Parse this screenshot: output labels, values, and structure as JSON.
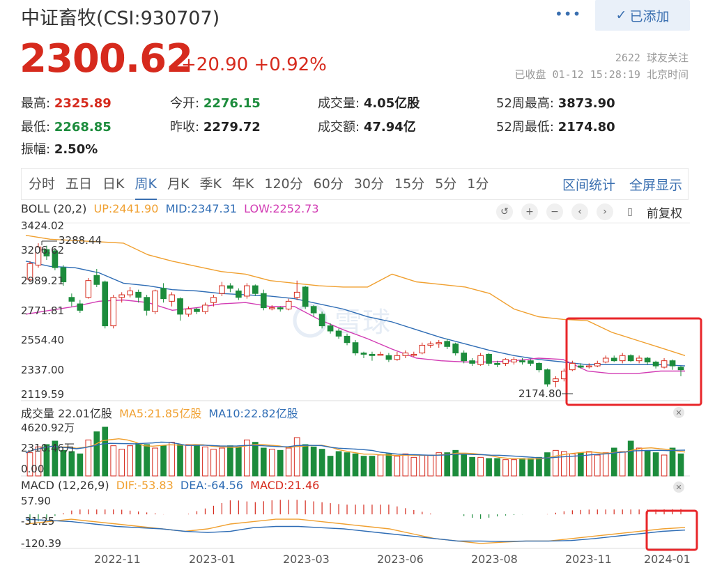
{
  "header": {
    "title": "中证畜牧(CSI:930707)",
    "more_icon": "more-dots-icon",
    "added_label": "已添加",
    "price": "2300.62",
    "change": "+20.90",
    "change_pct": "+0.92%",
    "followers": "2622 球友关注",
    "status": "已收盘 01-12 15:28:19 北京时间"
  },
  "quote": {
    "high_l": "最高:",
    "high_v": "2325.89",
    "low_l": "最低:",
    "low_v": "2268.85",
    "amp_l": "振幅:",
    "amp_v": "2.50%",
    "open_l": "今开:",
    "open_v": "2276.15",
    "prev_l": "昨收:",
    "prev_v": "2279.72",
    "vol_l": "成交量:",
    "vol_v": "4.05亿股",
    "amt_l": "成交额:",
    "amt_v": "47.94亿",
    "h52_l": "52周最高:",
    "h52_v": "3873.90",
    "l52_l": "52周最低:",
    "l52_v": "2174.80"
  },
  "tabs": [
    "分时",
    "五日",
    "日K",
    "周K",
    "月K",
    "季K",
    "年K",
    "120分",
    "60分",
    "30分",
    "15分",
    "5分",
    "1分"
  ],
  "active_tab": "周K",
  "tab_right": {
    "range_stats": "区间统计",
    "fullscreen": "全屏显示"
  },
  "boll_legend": {
    "name": "BOLL (20,2)",
    "up": "UP:2441.90",
    "mid": "MID:2347.31",
    "low": "LOW:2252.73"
  },
  "adjust_label": "前复权",
  "vol_legend": {
    "name": "成交量 22.01亿股",
    "ma5": "MA5:21.85亿股",
    "ma10": "MA10:22.82亿股"
  },
  "macd_legend": {
    "name": "MACD (12,26,9)",
    "dif": "DIF:-53.83",
    "dea": "DEA:-64.56",
    "macd": "MACD:21.46"
  },
  "price_axis": [
    "3424.02",
    "3206.62",
    "2989.21",
    "2771.81",
    "2554.40",
    "2337.00",
    "2119.59"
  ],
  "vol_axis": [
    "4620.92万",
    "2310.46万",
    "0.00"
  ],
  "macd_axis": [
    "57.90",
    "-31.25",
    "-120.39"
  ],
  "x_axis": [
    "2022-11",
    "2023-01",
    "2023-03",
    "2023-06",
    "2023-08",
    "2023-11",
    "2024-01"
  ],
  "annotations": {
    "max": "3288.44",
    "min": "2174.80"
  },
  "watermark": "雪球",
  "colors": {
    "up": "#d62a1d",
    "down": "#1c8c3c",
    "upper": "#f0a030",
    "mid": "#2f6db5",
    "lower": "#d23cb4",
    "accent": "#3a6fb0"
  },
  "chart_data": {
    "type": "candlestick",
    "title": "中证畜牧(CSI:930707)",
    "period": "weekly",
    "price_range": [
      2119.59,
      3424.02
    ],
    "candles": [
      [
        3010,
        3130,
        2990,
        3150
      ],
      [
        3120,
        3260,
        3100,
        3288.44
      ],
      [
        3240,
        3190,
        3160,
        3270
      ],
      [
        3230,
        3100,
        3080,
        3250
      ],
      [
        3100,
        2990,
        2960,
        3120
      ],
      [
        2870,
        2840,
        2800,
        2900
      ],
      [
        2820,
        2770,
        2750,
        2850
      ],
      [
        2870,
        3000,
        2860,
        3020
      ],
      [
        3040,
        2970,
        2950,
        3090
      ],
      [
        2990,
        2650,
        2630,
        3000
      ],
      [
        2650,
        2870,
        2630,
        2890
      ],
      [
        2870,
        2890,
        2830,
        2910
      ],
      [
        2890,
        2920,
        2870,
        2950
      ],
      [
        2910,
        2870,
        2830,
        2930
      ],
      [
        2870,
        2770,
        2730,
        2890
      ],
      [
        2760,
        2920,
        2740,
        2930
      ],
      [
        2940,
        2860,
        2830,
        2980
      ],
      [
        2840,
        2890,
        2800,
        2910
      ],
      [
        2860,
        2740,
        2690,
        2870
      ],
      [
        2740,
        2780,
        2720,
        2800
      ],
      [
        2780,
        2760,
        2740,
        2790
      ],
      [
        2760,
        2810,
        2740,
        2830
      ],
      [
        2830,
        2870,
        2800,
        2890
      ],
      [
        2900,
        2960,
        2880,
        2990
      ],
      [
        2960,
        2940,
        2910,
        2980
      ],
      [
        2920,
        2870,
        2850,
        2940
      ],
      [
        2880,
        2960,
        2860,
        2980
      ],
      [
        2960,
        2900,
        2880,
        2970
      ],
      [
        2900,
        2790,
        2770,
        2930
      ],
      [
        2790,
        2790,
        2770,
        2810
      ],
      [
        2790,
        2780,
        2760,
        2800
      ],
      [
        2780,
        2840,
        2770,
        2860
      ],
      [
        2870,
        2910,
        2850,
        3000
      ],
      [
        2950,
        2800,
        2780,
        2960
      ],
      [
        2800,
        2750,
        2720,
        2810
      ],
      [
        2740,
        2650,
        2630,
        2760
      ],
      [
        2650,
        2610,
        2590,
        2670
      ],
      [
        2610,
        2570,
        2550,
        2630
      ],
      [
        2570,
        2520,
        2500,
        2590
      ],
      [
        2520,
        2440,
        2420,
        2540
      ],
      [
        2440,
        2430,
        2400,
        2450
      ],
      [
        2430,
        2420,
        2380,
        2450
      ],
      [
        2430,
        2430,
        2420,
        2450
      ],
      [
        2420,
        2390,
        2370,
        2440
      ],
      [
        2390,
        2420,
        2380,
        2450
      ],
      [
        2420,
        2440,
        2400,
        2460
      ],
      [
        2430,
        2430,
        2410,
        2450
      ],
      [
        2440,
        2500,
        2430,
        2520
      ],
      [
        2500,
        2510,
        2480,
        2530
      ],
      [
        2510,
        2520,
        2480,
        2540
      ],
      [
        2530,
        2490,
        2470,
        2550
      ],
      [
        2510,
        2440,
        2420,
        2520
      ],
      [
        2440,
        2380,
        2360,
        2460
      ],
      [
        2380,
        2360,
        2340,
        2400
      ],
      [
        2350,
        2420,
        2340,
        2440
      ],
      [
        2430,
        2360,
        2340,
        2440
      ],
      [
        2360,
        2350,
        2330,
        2380
      ],
      [
        2360,
        2390,
        2340,
        2400
      ],
      [
        2370,
        2390,
        2350,
        2410
      ],
      [
        2380,
        2370,
        2350,
        2400
      ],
      [
        2380,
        2360,
        2340,
        2390
      ],
      [
        2360,
        2310,
        2290,
        2370
      ],
      [
        2310,
        2200,
        2180,
        2320
      ],
      [
        2220,
        2240,
        2174.8,
        2260
      ],
      [
        2240,
        2300,
        2220,
        2320
      ],
      [
        2310,
        2360,
        2300,
        2380
      ],
      [
        2340,
        2330,
        2320,
        2360
      ],
      [
        2340,
        2340,
        2320,
        2360
      ],
      [
        2340,
        2360,
        2330,
        2380
      ],
      [
        2370,
        2400,
        2360,
        2420
      ],
      [
        2400,
        2380,
        2370,
        2420
      ],
      [
        2380,
        2420,
        2360,
        2440
      ],
      [
        2420,
        2380,
        2370,
        2430
      ],
      [
        2380,
        2400,
        2360,
        2420
      ],
      [
        2400,
        2370,
        2350,
        2410
      ],
      [
        2370,
        2340,
        2320,
        2380
      ],
      [
        2330,
        2380,
        2320,
        2400
      ],
      [
        2380,
        2340,
        2310,
        2390
      ],
      [
        2330,
        2310,
        2260,
        2340
      ]
    ],
    "boll_upper": [
      3350,
      3320,
      3310,
      3300,
      3290,
      3200,
      3150,
      3110,
      3070,
      3050,
      3000,
      2980,
      2960,
      2950,
      2950,
      3050,
      2990,
      2970,
      2950,
      2900,
      2780,
      2720,
      2700,
      2690,
      2600,
      2540,
      2480,
      2420
    ],
    "boll_mid": [
      3150,
      3110,
      3100,
      3060,
      2980,
      2960,
      2930,
      2920,
      2900,
      2890,
      2880,
      2860,
      2820,
      2780,
      2720,
      2680,
      2620,
      2560,
      2510,
      2460,
      2420,
      2390,
      2370,
      2350,
      2350,
      2350,
      2350,
      2340
    ],
    "boll_lower": [
      2740,
      2770,
      2800,
      2840,
      2850,
      2830,
      2770,
      2790,
      2820,
      2830,
      2800,
      2800,
      2700,
      2620,
      2550,
      2470,
      2400,
      2380,
      2370,
      2370,
      2380,
      2400,
      2390,
      2300,
      2280,
      2280,
      2300,
      2300
    ],
    "volume_range": [
      0,
      4620.92
    ],
    "volume": [
      2000,
      2500,
      2700,
      3000,
      2200,
      2100,
      1900,
      3100,
      3800,
      4200,
      2600,
      2300,
      2600,
      2800,
      2700,
      2400,
      2600,
      2900,
      2700,
      2700,
      2600,
      2500,
      2300,
      2400,
      2600,
      2500,
      3100,
      2900,
      2400,
      2300,
      2200,
      2400,
      3300,
      2700,
      2500,
      2300,
      1700,
      2100,
      2000,
      1900,
      1700,
      1700,
      1800,
      1900,
      1700,
      1900,
      1600,
      1800,
      1800,
      2000,
      2000,
      2200,
      1800,
      1600,
      1600,
      1500,
      1500,
      1400,
      1400,
      1500,
      1500,
      1600,
      2000,
      2200,
      2100,
      1900,
      2000,
      2100,
      1800,
      2000,
      2400,
      2100,
      3000,
      2400,
      2200,
      2000,
      1800,
      2400,
      1900
    ],
    "macd_range": [
      -120.39,
      57.9
    ],
    "macd_dif": [
      -40,
      -30,
      -20,
      -30,
      -40,
      -50,
      -60,
      -70,
      -60,
      -40,
      -30,
      -20,
      -20,
      -30,
      -40,
      -50,
      -60,
      -80,
      -100,
      -110,
      -120,
      -115,
      -110,
      -110,
      -100,
      -90,
      -80,
      -70,
      -60,
      -54
    ],
    "macd_dea": [
      -20,
      -25,
      -30,
      -40,
      -50,
      -55,
      -60,
      -70,
      -75,
      -70,
      -55,
      -50,
      -50,
      -55,
      -60,
      -70,
      -80,
      -90,
      -100,
      -110,
      -110,
      -112,
      -110,
      -110,
      -108,
      -100,
      -90,
      -80,
      -70,
      -65
    ]
  }
}
